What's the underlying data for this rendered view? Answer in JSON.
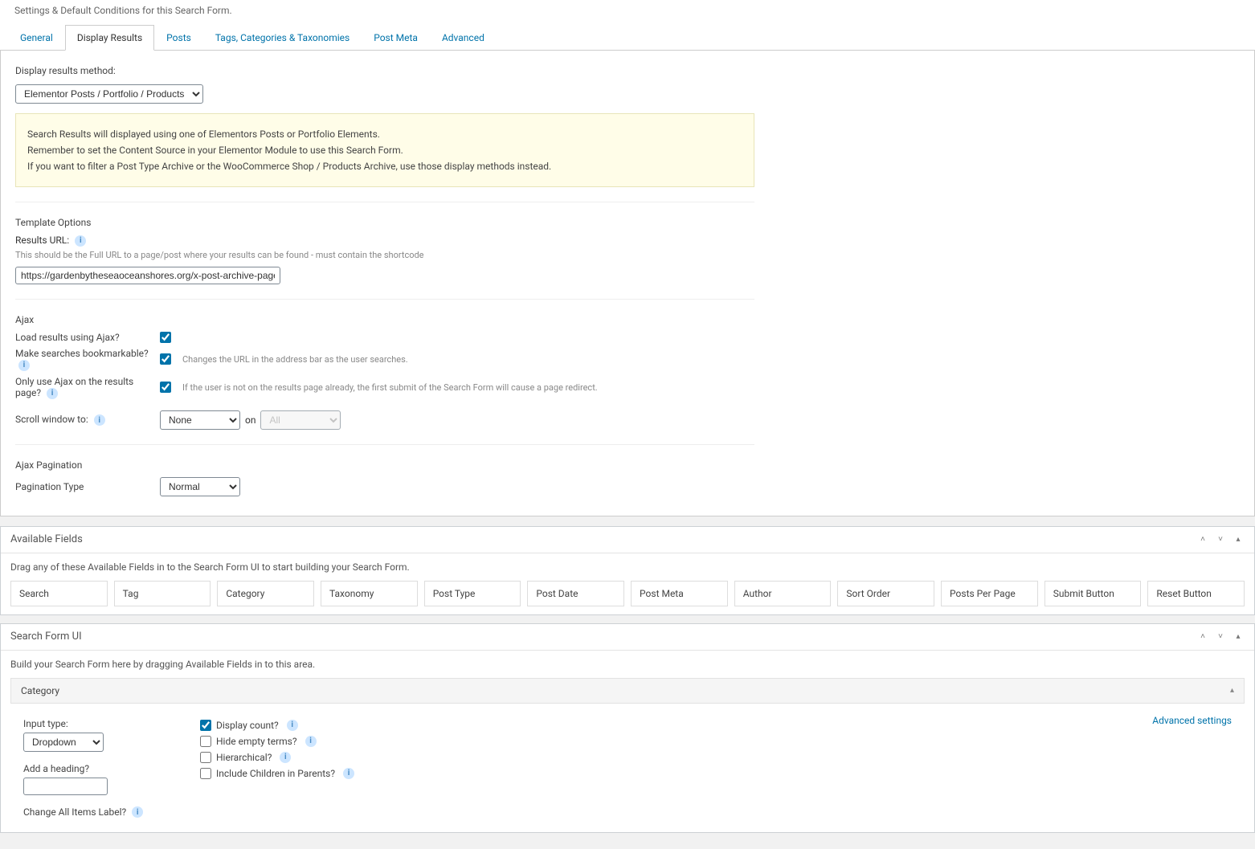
{
  "top_description": "Settings & Default Conditions for this Search Form.",
  "tabs": {
    "general": "General",
    "display_results": "Display Results",
    "posts": "Posts",
    "taxonomies": "Tags, Categories & Taxonomies",
    "post_meta": "Post Meta",
    "advanced": "Advanced"
  },
  "display_results": {
    "method_label": "Display results method:",
    "method_value": "Elementor Posts / Portfolio / Products",
    "notice": {
      "line1": "Search Results will displayed using one of Elementors Posts or Portfolio Elements.",
      "line2": "Remember to set the Content Source in your Elementor Module to use this Search Form.",
      "line3": "If you want to filter a Post Type Archive or the WooCommerce Shop / Products Archive, use those display methods instead."
    },
    "template_options_heading": "Template Options",
    "results_url_label": "Results URL:",
    "results_url_help": "This should be the Full URL to a page/post where your results can be found - must contain the shortcode",
    "results_url_value": "https://gardenbytheseaoceanshores.org/x-post-archive-page/",
    "ajax_heading": "Ajax",
    "ajax_load_label": "Load results using Ajax?",
    "ajax_bookmarkable_label": "Make searches bookmarkable?",
    "ajax_bookmarkable_desc": "Changes the URL in the address bar as the user searches.",
    "ajax_only_results_label": "Only use Ajax on the results page?",
    "ajax_only_results_desc": "If the user is not on the results page already, the first submit of the Search Form will cause a page redirect.",
    "scroll_label": "Scroll window to:",
    "scroll_value": "None",
    "scroll_on": "on",
    "scroll_all": "All",
    "pagination_heading": "Ajax Pagination",
    "pagination_type_label": "Pagination Type",
    "pagination_type_value": "Normal"
  },
  "available_fields": {
    "title": "Available Fields",
    "desc": "Drag any of these Available Fields in to the Search Form UI to start building your Search Form.",
    "items": [
      "Search",
      "Tag",
      "Category",
      "Taxonomy",
      "Post Type",
      "Post Date",
      "Post Meta",
      "Author",
      "Sort Order",
      "Posts Per Page",
      "Submit Button",
      "Reset Button"
    ]
  },
  "search_form_ui": {
    "title": "Search Form UI",
    "desc": "Build your Search Form here by dragging Available Fields in to this area.",
    "category": {
      "bar_title": "Category",
      "input_type_label": "Input type:",
      "input_type_value": "Dropdown",
      "add_heading_label": "Add a heading?",
      "add_heading_value": "",
      "change_all_items_label": "Change All Items Label?",
      "display_count_label": "Display count?",
      "hide_empty_label": "Hide empty terms?",
      "hierarchical_label": "Hierarchical?",
      "include_children_label": "Include Children in Parents?",
      "advanced_settings": "Advanced settings"
    }
  }
}
